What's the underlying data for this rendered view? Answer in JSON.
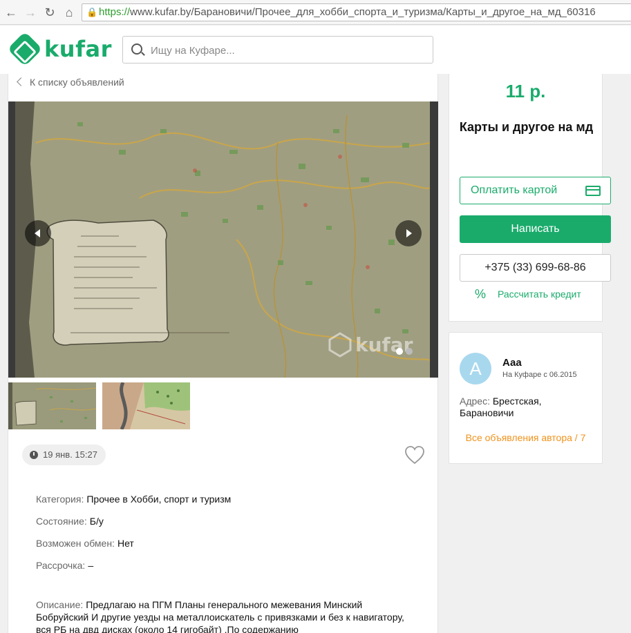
{
  "browser": {
    "url_scheme": "https://",
    "url_rest": "www.kufar.by/Барановичи/Прочее_для_хобби_спорта_и_туризма/Карты_и_другое_на_мд_60316"
  },
  "header": {
    "logo_text": "kufar",
    "search_placeholder": "Ищу на Куфаре..."
  },
  "listing": {
    "back_label": "К списку объявлений",
    "date": "19 янв. 15:27",
    "properties": [
      {
        "key": "Категория:",
        "value": "Прочее в Хобби, спорт и туризм"
      },
      {
        "key": "Состояние:",
        "value": "Б/у"
      },
      {
        "key": "Возможен обмен:",
        "value": "Нет"
      },
      {
        "key": "Рассрочка:",
        "value": "–"
      }
    ],
    "description_key": "Описание:",
    "description": "Предлагаю на ПГМ Планы генерального межевания Минский Бобруйский И другие уезды на металлоискатель с привязками и без к навигатору, вся РБ на двд дисках (около 14 гигобайт) .По содержанию"
  },
  "gallery": {
    "watermark": "kufar",
    "dot_count": 2,
    "active_dot": 0
  },
  "offer": {
    "price": "11 р.",
    "title": "Карты и другое на мд",
    "pay_label": "Оплатить картой",
    "write_label": "Написать",
    "phone": "+375 (33) 699-68-86",
    "credit_label": "Рассчитать кредит"
  },
  "seller": {
    "avatar_letter": "А",
    "name": "Ааа",
    "since": "На Куфаре с 06.2015",
    "address_key": "Адрес:",
    "address_value": "Брестская, Барановичи",
    "all_ads": "Все объявления автора / 7"
  },
  "colors": {
    "brand": "#1aab6b",
    "link_orange": "#f0921a",
    "avatar": "#a8d8ee"
  }
}
